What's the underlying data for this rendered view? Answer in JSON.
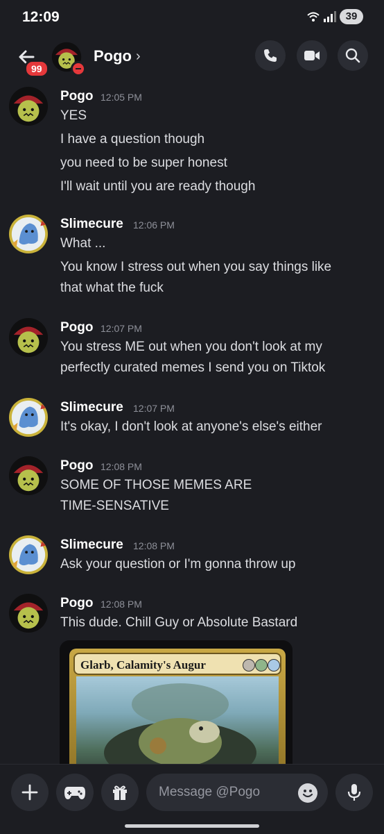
{
  "status_bar": {
    "time": "12:09",
    "battery": "39"
  },
  "header": {
    "unread_badge": "99",
    "name": "Pogo",
    "chevron": "›"
  },
  "messages": [
    {
      "author": "Pogo",
      "time": "12:05 PM",
      "lines": [
        "YES",
        "I have a question though",
        "you need to be super honest",
        "I'll wait until you are ready though"
      ]
    },
    {
      "author": "Slimecure",
      "time": "12:06 PM",
      "lines": [
        "What ...",
        "You know I stress out when you say things like",
        "that what the fuck"
      ]
    },
    {
      "author": "Pogo",
      "time": "12:07 PM",
      "lines": [
        "You stress ME out when you don't look at my",
        "perfectly curated memes I send you on Tiktok"
      ]
    },
    {
      "author": "Slimecure",
      "time": "12:07 PM",
      "lines": [
        "It's okay, I don't look at anyone's else's either"
      ]
    },
    {
      "author": "Pogo",
      "time": "12:08 PM",
      "lines": [
        "SOME OF THOSE MEMES ARE",
        "TIME-SENSATIVE"
      ]
    },
    {
      "author": "Slimecure",
      "time": "12:08 PM",
      "lines": [
        "Ask your question or I'm gonna throw up"
      ]
    },
    {
      "author": "Pogo",
      "time": "12:08 PM",
      "lines": [
        "This dude. Chill Guy or Absolute Bastard"
      ]
    }
  ],
  "attachment": {
    "card_name": "Glarb, Calamity's Augur"
  },
  "composer": {
    "placeholder": "Message @Pogo"
  },
  "colors": {
    "background": "#1c1d22",
    "button_bg": "#2b2d34",
    "badge_red": "#e5383b",
    "timestamp_gray": "#8e9099"
  }
}
